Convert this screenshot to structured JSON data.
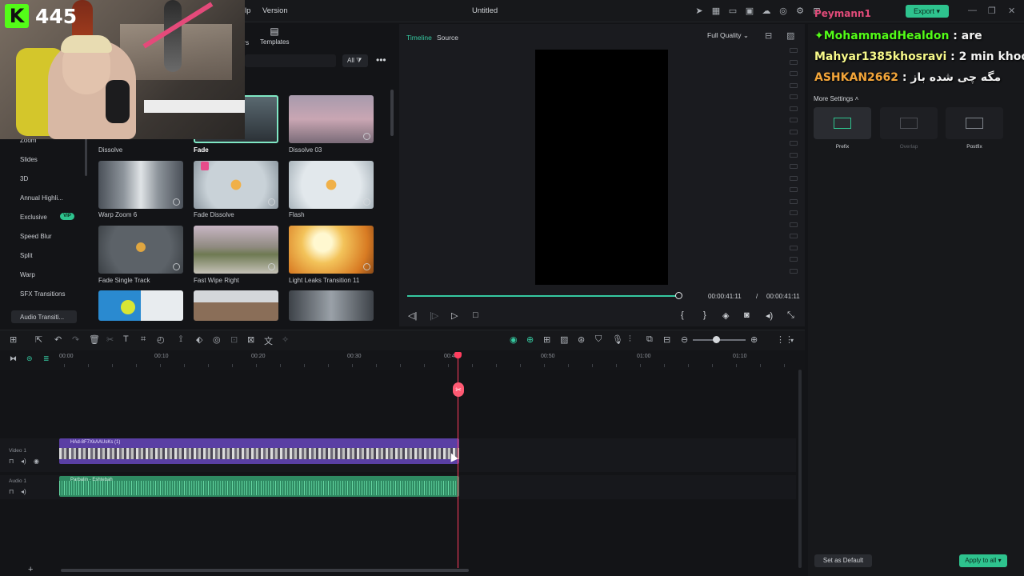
{
  "menu": {
    "help_stub": "lp",
    "version": "Version"
  },
  "document": {
    "title": "Untitled"
  },
  "topbar": {
    "export_label": "Export",
    "icons": [
      "send-icon",
      "layout-icon",
      "monitor-icon",
      "save-icon",
      "cloud-icon",
      "support-icon",
      "settings-icon",
      "grid-icon"
    ],
    "window": [
      "minimize-icon",
      "restore-icon",
      "close-icon"
    ]
  },
  "stream": {
    "viewer_count": "445",
    "kick_letter": "K"
  },
  "library": {
    "tabs": {
      "stub": "ers",
      "templates": "Templates"
    },
    "all_filter": "All",
    "categories": [
      "Zoom",
      "Slides",
      "3D",
      "Annual Highli...",
      "Exclusive",
      "Speed Blur",
      "Split",
      "Warp",
      "SFX Transitions",
      "Audio Transiti..."
    ],
    "vip": "VIP",
    "thumbs": [
      {
        "label": "Dissolve"
      },
      {
        "label": "Fade"
      },
      {
        "label": "Dissolve 03"
      },
      {
        "label": "Warp Zoom 6"
      },
      {
        "label": "Fade Dissolve"
      },
      {
        "label": "Flash"
      },
      {
        "label": "Fade Single Track"
      },
      {
        "label": "Fast Wipe Right"
      },
      {
        "label": "Light Leaks Transition 11"
      }
    ]
  },
  "preview": {
    "tab_timeline": "Timeline",
    "tab_source": "Source",
    "quality": "Full Quality",
    "time_current": "00:00:41:11",
    "time_sep": "/",
    "time_total": "00:00:41:11",
    "progress": 1.0
  },
  "chat": {
    "stub": "Peymann1",
    "messages": [
      {
        "user": "MohammadHealdon",
        "text": ": are"
      },
      {
        "user": "Mahyar1385khosravi",
        "text": ": 2 min khoobe"
      },
      {
        "user": "ASHKAN2662",
        "text": ": مگه چی شده باز"
      }
    ]
  },
  "settings": {
    "more_settings": "More Settings",
    "options": [
      {
        "label": "Prefix",
        "active": true
      },
      {
        "label": "Overlap",
        "active": false
      },
      {
        "label": "Postfix",
        "active": false
      }
    ],
    "set_default": "Set as Default",
    "apply_all": "Apply to all"
  },
  "timeline": {
    "ruler": [
      "00:00",
      "00:10",
      "00:20",
      "00:30",
      "00:40",
      "00:50",
      "01:00",
      "01:10"
    ],
    "video_track": "Video 1",
    "audio_track": "Audio 1",
    "video_clip_name": "HAd-8F7XkAAUsKs (1)",
    "audio_clip_name": "Parbalin - Eshtebah"
  }
}
